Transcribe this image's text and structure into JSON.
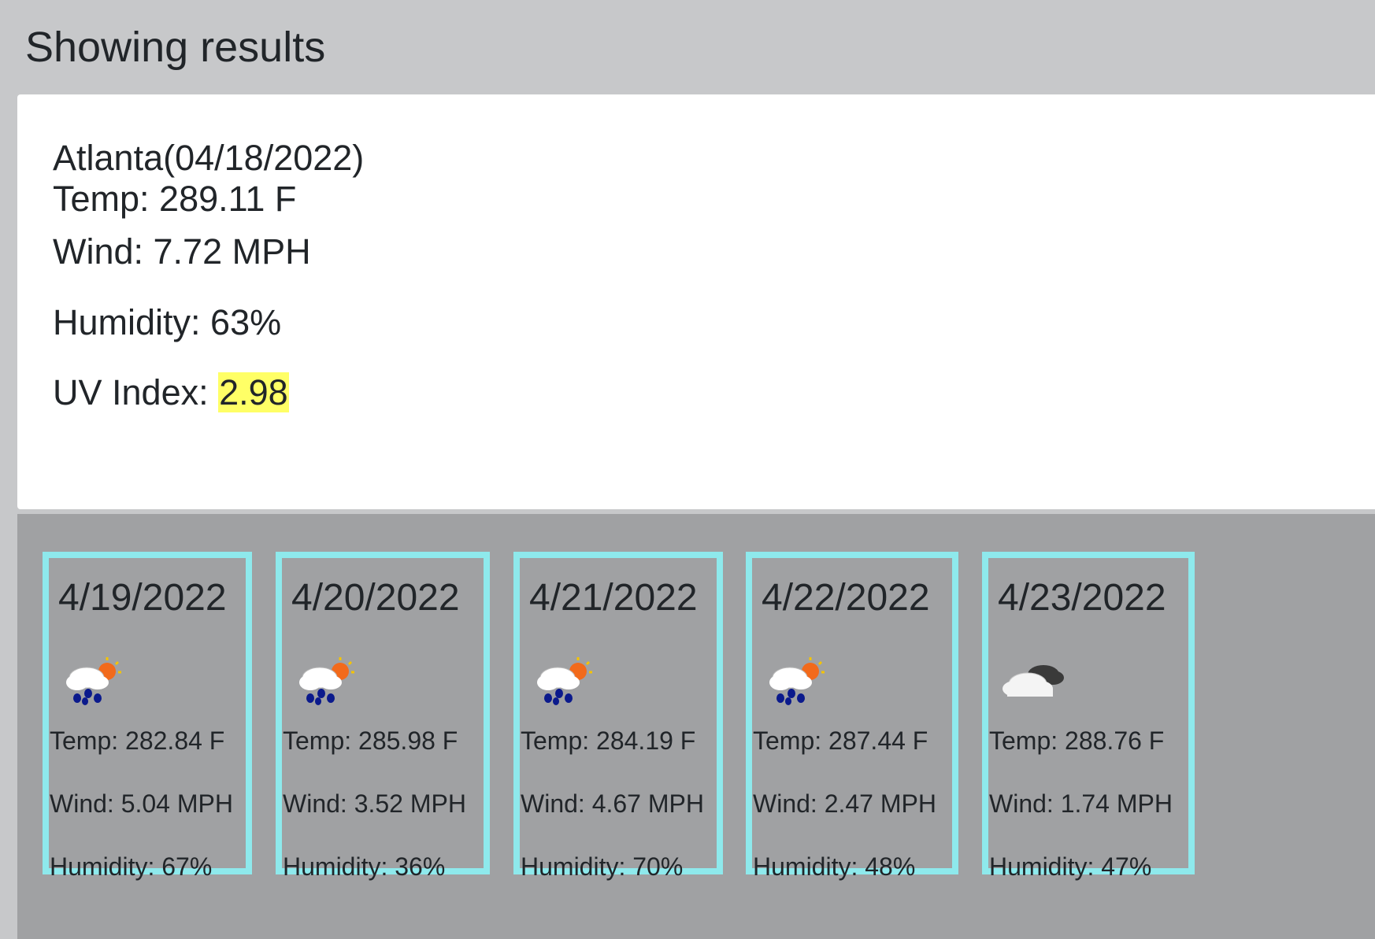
{
  "heading": "Showing results",
  "current": {
    "title": "Atlanta(04/18/2022)",
    "temp": "Temp: 289.11 F",
    "wind": "Wind: 7.72 MPH",
    "humidity": "Humidity: 63%",
    "uv_label": "UV Index: ",
    "uv_value": "2.98",
    "uv_color": "#ffff66"
  },
  "forecast": [
    {
      "date": "4/19/2022",
      "icon": "rain-sun-icon",
      "temp": "Temp: 282.84 F",
      "wind": "Wind: 5.04 MPH",
      "humidity": "Humidity: 67%"
    },
    {
      "date": "4/20/2022",
      "icon": "rain-sun-icon",
      "temp": "Temp: 285.98 F",
      "wind": "Wind: 3.52 MPH",
      "humidity": "Humidity: 36%"
    },
    {
      "date": "4/21/2022",
      "icon": "rain-sun-icon",
      "temp": "Temp: 284.19 F",
      "wind": "Wind: 4.67 MPH",
      "humidity": "Humidity: 70%"
    },
    {
      "date": "4/22/2022",
      "icon": "rain-sun-icon",
      "temp": "Temp: 287.44 F",
      "wind": "Wind: 2.47 MPH",
      "humidity": "Humidity: 48%"
    },
    {
      "date": "4/23/2022",
      "icon": "cloudy-icon",
      "temp": "Temp: 288.76 F",
      "wind": "Wind: 1.74 MPH",
      "humidity": "Humidity: 47%"
    }
  ],
  "colors": {
    "page_bg": "#c7c8ca",
    "forecast_bg": "#a0a1a3",
    "card_border": "#8ee9ec"
  }
}
